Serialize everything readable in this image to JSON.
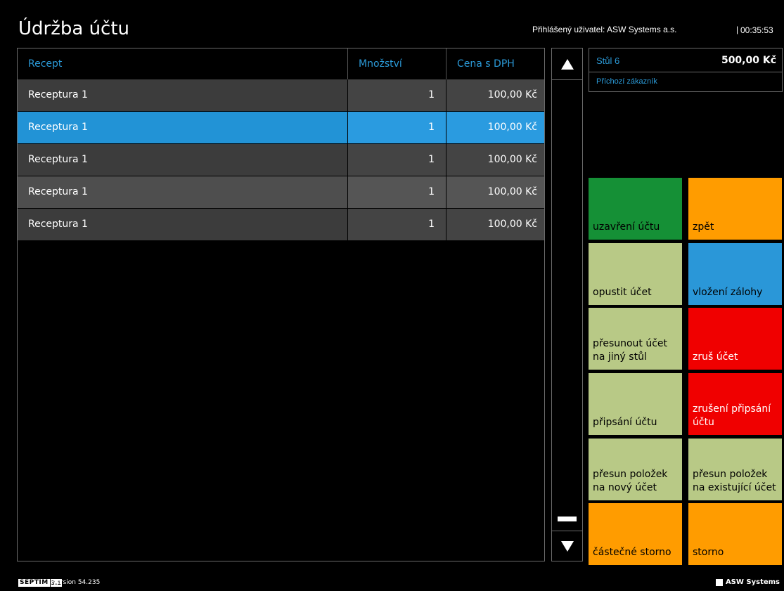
{
  "header": {
    "title": "Údržba účtu",
    "login_label": "Přihlášený uživatel: ASW Systems a.s.",
    "separator": "|",
    "clock": "00:35:53"
  },
  "table": {
    "columns": [
      "Recept",
      "Množství",
      "Cena s DPH"
    ],
    "rows": [
      {
        "name": "Receptura 1",
        "qty": "1",
        "price": "100,00 Kč",
        "state": "normal"
      },
      {
        "name": "Receptura 1",
        "qty": "1",
        "price": "100,00 Kč",
        "state": "selected"
      },
      {
        "name": "Receptura 1",
        "qty": "1",
        "price": "100,00 Kč",
        "state": "normal"
      },
      {
        "name": "Receptura 1",
        "qty": "1",
        "price": "100,00 Kč",
        "state": "alt"
      },
      {
        "name": "Receptura 1",
        "qty": "1",
        "price": "100,00 Kč",
        "state": "normal"
      }
    ]
  },
  "scrollbar": {
    "up_icon": "triangle-up-icon",
    "down_icon": "triangle-down-icon"
  },
  "table_info": {
    "table_name": "Stůl 6",
    "total": "500,00 Kč",
    "customer": "Příchozí zákazník"
  },
  "actions": {
    "close_account": "uzavření účtu",
    "back": "zpět",
    "leave_account": "opustit účet",
    "deposit": "vložení zálohy",
    "move_account": "přesunout účet na jiný stůl",
    "cancel_account": "zruš účet",
    "post_account": "připsání účtu",
    "cancel_post": "zrušení připsání účtu",
    "move_items_new": "přesun položek na nový účet",
    "move_items_existing": "přesun položek na existující účet",
    "partial_storno": "částečné storno",
    "storno": "storno"
  },
  "colors": {
    "accent_blue": "#2b9ad8",
    "green": "#159036",
    "orange": "#ff9c00",
    "khaki": "#b8c986",
    "blue": "#2a97d8",
    "red": "#f00000"
  },
  "footer": {
    "logo_word": "SEPTIM",
    "logo_version": "3.1",
    "version": "version 54.235",
    "company": "ASW Systems"
  }
}
